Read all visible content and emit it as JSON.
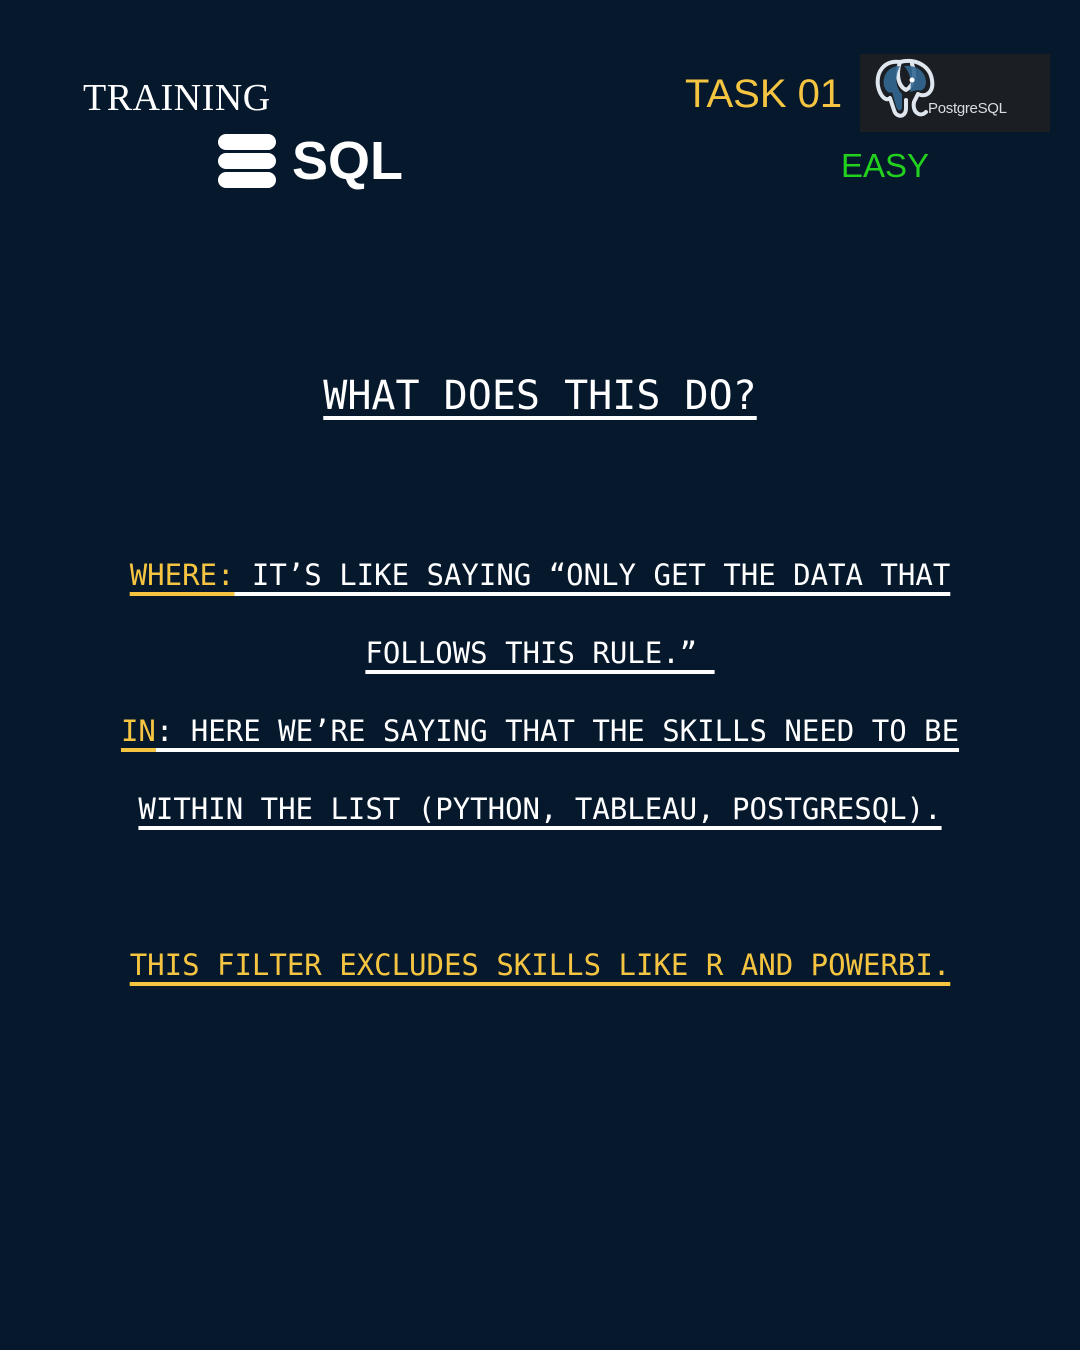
{
  "header": {
    "training_label": "TRAINING",
    "sql_logo_text": "SQL",
    "task_label": "TASK 01",
    "postgres_logo_text": "PostgreSQL",
    "difficulty": "EASY"
  },
  "content": {
    "question": "WHAT DOES THIS DO?",
    "where_keyword": "WHERE:",
    "where_text_1": " IT’S LIKE SAYING “ONLY GET THE DATA THAT",
    "where_text_2": "FOLLOWS THIS RULE.” ",
    "in_keyword": "IN",
    "in_text_1": ": HERE WE’RE SAYING THAT THE SKILLS NEED TO BE",
    "in_text_2": "WITHIN THE LIST (PYTHON, TABLEAU, POSTGRESQL).",
    "note": "THIS FILTER EXCLUDES SKILLS LIKE R AND POWERBI."
  },
  "colors": {
    "background": "#06182c",
    "accent_yellow": "#f5c542",
    "easy_green": "#22d11e",
    "text_white": "#ffffff"
  }
}
